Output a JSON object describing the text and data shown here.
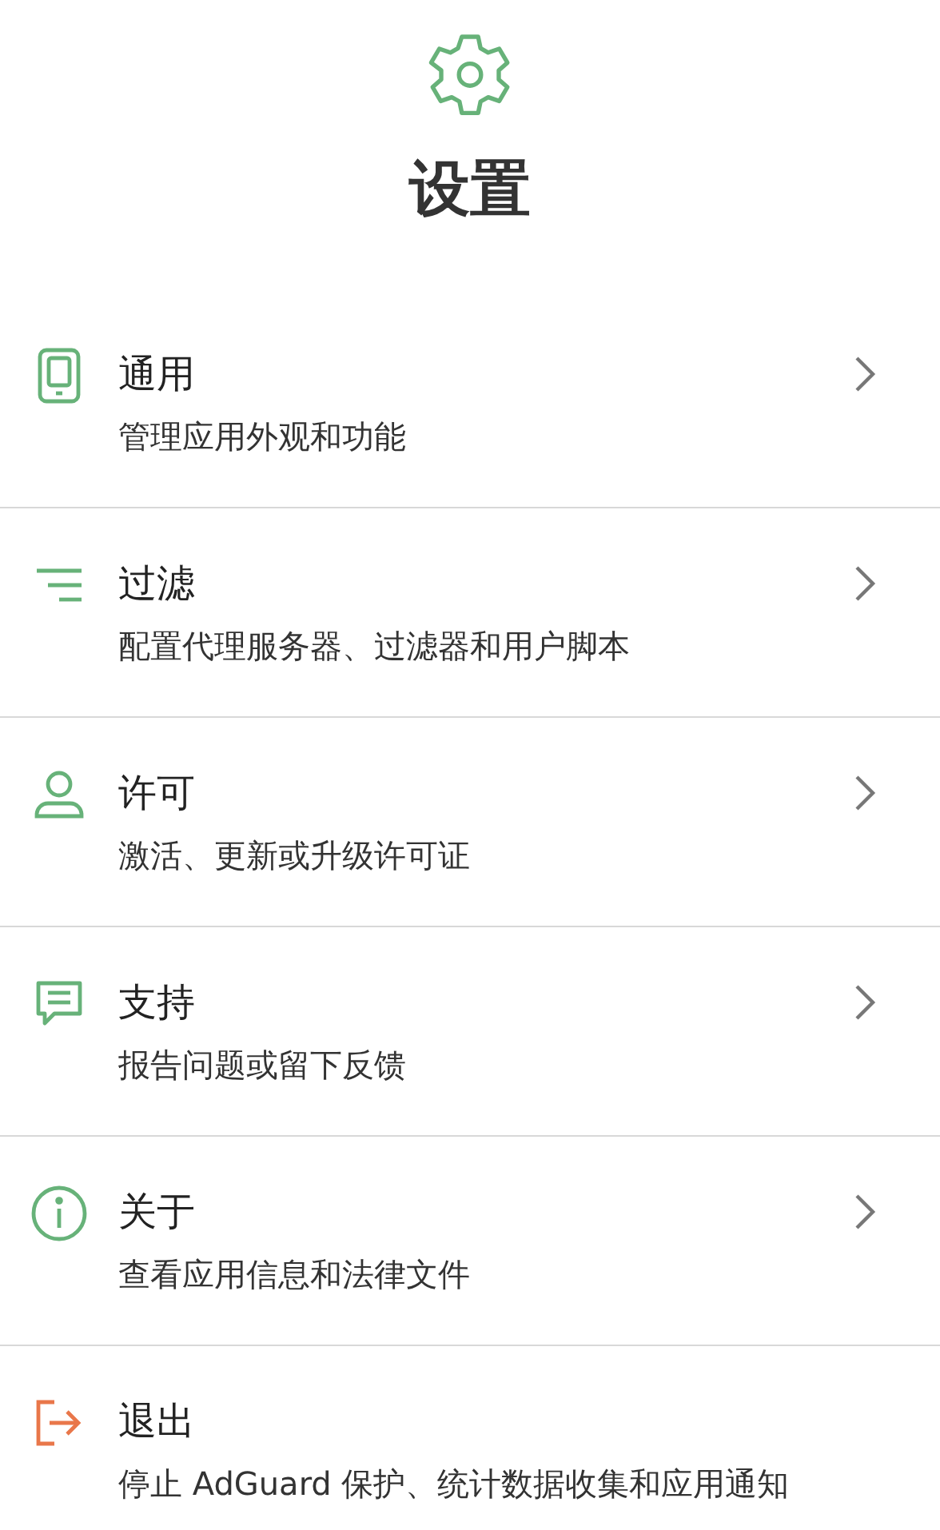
{
  "header": {
    "title": "设置"
  },
  "items": [
    {
      "kind": "phone",
      "title": "通用",
      "subtitle": "管理应用外观和功能",
      "chevron": true
    },
    {
      "kind": "filter",
      "title": "过滤",
      "subtitle": "配置代理服务器、过滤器和用户脚本",
      "chevron": true
    },
    {
      "kind": "person",
      "title": "许可",
      "subtitle": "激活、更新或升级许可证",
      "chevron": true
    },
    {
      "kind": "chat",
      "title": "支持",
      "subtitle": "报告问题或留下反馈",
      "chevron": true
    },
    {
      "kind": "info",
      "title": "关于",
      "subtitle": "查看应用信息和法律文件",
      "chevron": true
    },
    {
      "kind": "exit",
      "title": "退出",
      "subtitle": "停止 AdGuard 保护、统计数据收集和应用通知",
      "chevron": false
    }
  ]
}
